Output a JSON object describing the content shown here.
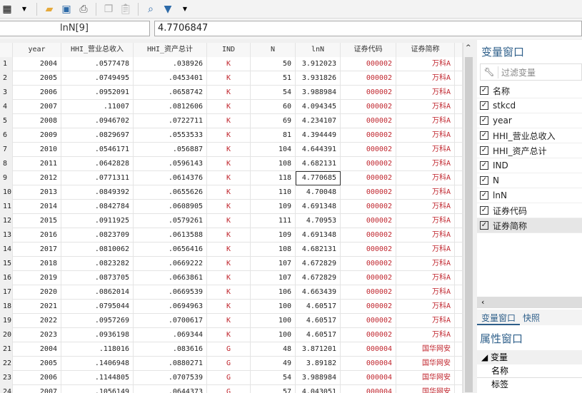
{
  "toolbar": {
    "icons": [
      "grid-icon",
      "dropdown-icon",
      "open-folder-icon",
      "save-icon",
      "print-icon",
      "copy-icon",
      "paste-icon",
      "search-icon",
      "filter-icon",
      "dropdown-icon"
    ]
  },
  "editbar": {
    "varname": "lnN[9]",
    "value": "4.7706847"
  },
  "grid": {
    "headers": [
      "year",
      "HHI_营业总收入",
      "HHI_资产总计",
      "IND",
      "N",
      "lnN",
      "证券代码",
      "证券简称"
    ],
    "rows": [
      [
        "1",
        "2004",
        ".0577478",
        ".038926",
        "K",
        "50",
        "3.912023",
        "000002",
        "万科A"
      ],
      [
        "2",
        "2005",
        ".0749495",
        ".0453401",
        "K",
        "51",
        "3.931826",
        "000002",
        "万科A"
      ],
      [
        "3",
        "2006",
        ".0952091",
        ".0658742",
        "K",
        "54",
        "3.988984",
        "000002",
        "万科A"
      ],
      [
        "4",
        "2007",
        ".11007",
        ".0812606",
        "K",
        "60",
        "4.094345",
        "000002",
        "万科A"
      ],
      [
        "5",
        "2008",
        ".0946702",
        ".0722711",
        "K",
        "69",
        "4.234107",
        "000002",
        "万科A"
      ],
      [
        "6",
        "2009",
        ".0829697",
        ".0553533",
        "K",
        "81",
        "4.394449",
        "000002",
        "万科A"
      ],
      [
        "7",
        "2010",
        ".0546171",
        ".056887",
        "K",
        "104",
        "4.644391",
        "000002",
        "万科A"
      ],
      [
        "8",
        "2011",
        ".0642828",
        ".0596143",
        "K",
        "108",
        "4.682131",
        "000002",
        "万科A"
      ],
      [
        "9",
        "2012",
        ".0771311",
        ".0614376",
        "K",
        "118",
        "4.770685",
        "000002",
        "万科A"
      ],
      [
        "10",
        "2013",
        ".0849392",
        ".0655626",
        "K",
        "110",
        "4.70048",
        "000002",
        "万科A"
      ],
      [
        "11",
        "2014",
        ".0842784",
        ".0608905",
        "K",
        "109",
        "4.691348",
        "000002",
        "万科A"
      ],
      [
        "12",
        "2015",
        ".0911925",
        ".0579261",
        "K",
        "111",
        "4.70953",
        "000002",
        "万科A"
      ],
      [
        "13",
        "2016",
        ".0823709",
        ".0613588",
        "K",
        "109",
        "4.691348",
        "000002",
        "万科A"
      ],
      [
        "14",
        "2017",
        ".0810062",
        ".0656416",
        "K",
        "108",
        "4.682131",
        "000002",
        "万科A"
      ],
      [
        "15",
        "2018",
        ".0823282",
        ".0669222",
        "K",
        "107",
        "4.672829",
        "000002",
        "万科A"
      ],
      [
        "16",
        "2019",
        ".0873705",
        ".0663861",
        "K",
        "107",
        "4.672829",
        "000002",
        "万科A"
      ],
      [
        "17",
        "2020",
        ".0862014",
        ".0669539",
        "K",
        "106",
        "4.663439",
        "000002",
        "万科A"
      ],
      [
        "18",
        "2021",
        ".0795044",
        ".0694963",
        "K",
        "100",
        "4.60517",
        "000002",
        "万科A"
      ],
      [
        "19",
        "2022",
        ".0957269",
        ".0700617",
        "K",
        "100",
        "4.60517",
        "000002",
        "万科A"
      ],
      [
        "20",
        "2023",
        ".0936198",
        ".069344",
        "K",
        "100",
        "4.60517",
        "000002",
        "万科A"
      ],
      [
        "21",
        "2004",
        ".118016",
        ".083616",
        "G",
        "48",
        "3.871201",
        "000004",
        "国华网安"
      ],
      [
        "22",
        "2005",
        ".1406948",
        ".0880271",
        "G",
        "49",
        "3.89182",
        "000004",
        "国华网安"
      ],
      [
        "23",
        "2006",
        ".1144805",
        ".0707539",
        "G",
        "54",
        "3.988984",
        "000004",
        "国华网安"
      ],
      [
        "24",
        "2007",
        ".1056149",
        ".0644373",
        "G",
        "57",
        "4.043051",
        "000004",
        "国华网安"
      ]
    ]
  },
  "varpanel": {
    "title": "变量窗口",
    "filter_placeholder": "过滤变量",
    "header": "名称",
    "vars": [
      "stkcd",
      "year",
      "HHI_营业总收入",
      "HHI_资产总计",
      "IND",
      "N",
      "lnN",
      "证券代码",
      "证券简称"
    ],
    "tabs": [
      "变量窗口",
      "快照"
    ]
  },
  "proppanel": {
    "title": "属性窗口",
    "section": "变量",
    "fields": [
      "名称",
      "标签"
    ]
  }
}
